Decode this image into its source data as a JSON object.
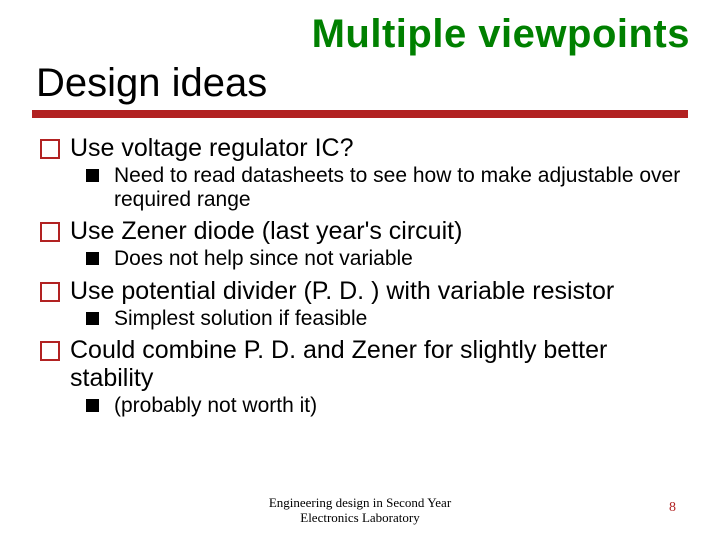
{
  "header": {
    "callout": "Multiple viewpoints",
    "title": "Design ideas"
  },
  "bullets": [
    {
      "text": "Use voltage regulator IC?",
      "sub": [
        "Need to read datasheets to see how to make adjustable over required range"
      ]
    },
    {
      "text": "Use Zener diode (last year's circuit)",
      "sub": [
        "Does not help since not variable"
      ]
    },
    {
      "text": "Use potential divider (P. D. ) with variable resistor",
      "sub": [
        "Simplest solution if feasible"
      ]
    },
    {
      "text": "Could combine P. D. and Zener for slightly better stability",
      "sub": [
        "(probably not worth it)"
      ]
    }
  ],
  "footer": {
    "line1": "Engineering design in Second Year",
    "line2": "Electronics Laboratory"
  },
  "page_number": "8"
}
